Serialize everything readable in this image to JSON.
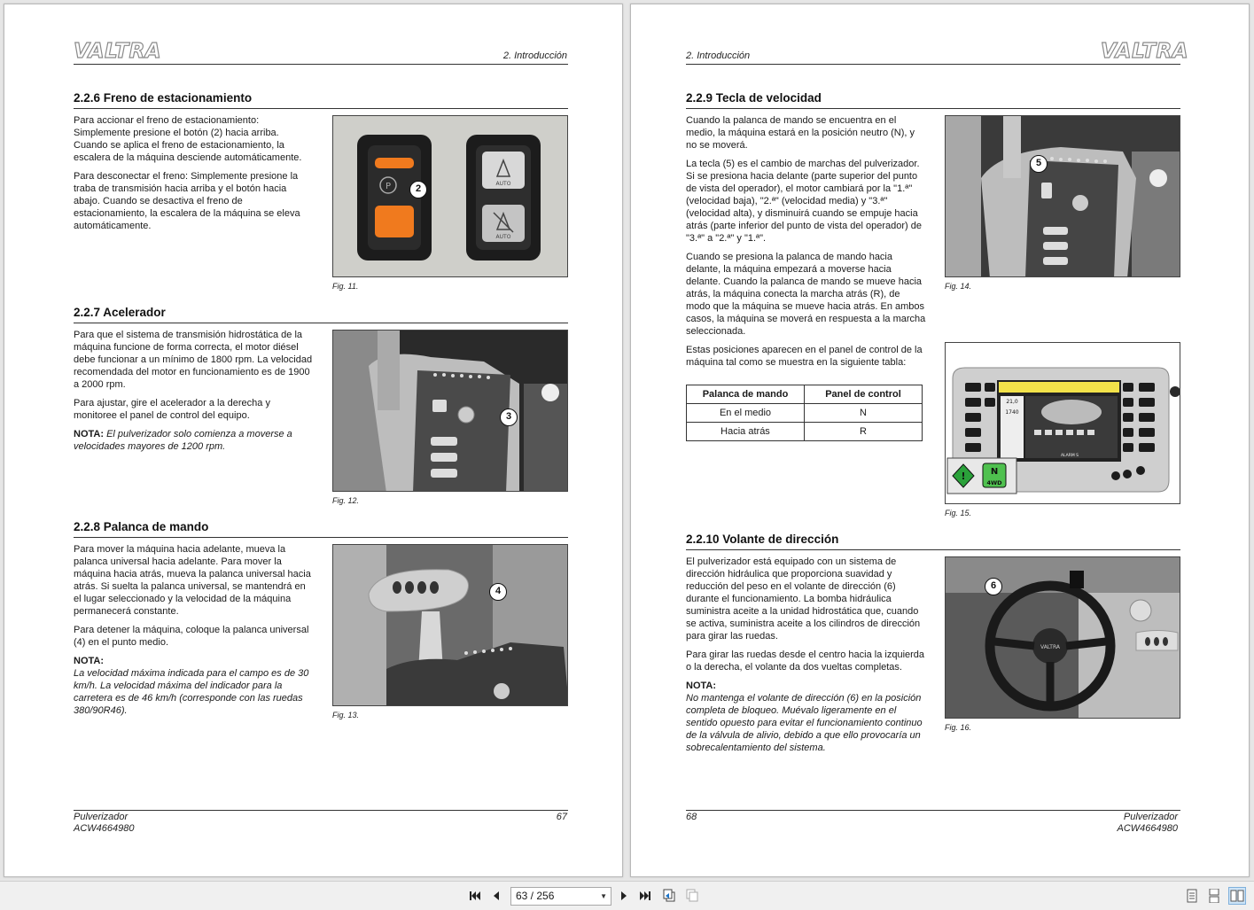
{
  "brand": "VALTRA",
  "left_page": {
    "running_head": "2. Introducción",
    "sections": [
      {
        "heading": "2.2.6  Freno de estacionamiento",
        "paragraphs": [
          "Para accionar el freno de estacionamiento: Simplemente presione el botón (2) hacia arriba. Cuando se aplica el freno de estacionamiento, la escalera de la máquina desciende automáticamente.",
          "Para desconectar el freno: Simplemente presione la traba de transmisión hacia arriba y el botón hacia abajo. Cuando se desactiva el freno de estacionamiento, la escalera de la máquina se eleva automáticamente."
        ],
        "figure_caption": "Fig. 11.",
        "callout": "2",
        "auto_label": "AUTO"
      },
      {
        "heading": "2.2.7  Acelerador",
        "paragraphs": [
          "Para que el sistema de transmisión hidrostática de la máquina funcione de forma correcta, el motor diésel debe funcionar a un mínimo de 1800 rpm. La velocidad recomendada del motor en funcionamiento es de 1900 a 2000 rpm.",
          "Para ajustar, gire el acelerador a la derecha y monitoree el panel de control del equipo."
        ],
        "note_label": "NOTA:",
        "note_text": "El pulverizador solo comienza a moverse a velocidades mayores de 1200 rpm.",
        "figure_caption": "Fig. 12.",
        "callout": "3"
      },
      {
        "heading": "2.2.8  Palanca de mando",
        "paragraphs": [
          "Para mover la máquina hacia adelante, mueva la palanca universal hacia adelante. Para mover la máquina hacia atrás, mueva la palanca universal hacia atrás. Si suelta la palanca universal, se mantendrá en el lugar seleccionado y la velocidad de la máquina permanecerá constante.",
          "Para detener la máquina, coloque la palanca universal (4) en el punto medio."
        ],
        "note_label": "NOTA:",
        "note_text": "La velocidad máxima indicada para el campo es de 30 km/h. La velocidad máxima del indicador para la carretera es de 46 km/h (corresponde con las ruedas 380/90R46).",
        "figure_caption": "Fig. 13.",
        "callout": "4"
      }
    ],
    "footer_left_1": "Pulverizador",
    "footer_left_2": "ACW4664980",
    "page_number": "67"
  },
  "right_page": {
    "running_head": "2. Introducción",
    "sections": [
      {
        "heading": "2.2.9  Tecla de velocidad",
        "paragraphs": [
          "Cuando la palanca de mando se encuentra en el medio, la máquina estará en la posición neutro (N), y no se moverá.",
          "La tecla (5) es el cambio de marchas del pulverizador. Si se presiona hacia delante (parte superior del punto de vista del operador), el motor cambiará por la \"1.ª\" (velocidad baja), \"2.ª\" (velocidad media) y \"3.ª\" (velocidad alta), y disminuirá cuando se empuje hacia atrás (parte inferior del punto de vista del operador) de \"3.ª\" a \"2.ª\" y \"1.ª\".",
          "Cuando se presiona la palanca de mando hacia delante, la máquina empezará a moverse hacia delante. Cuando la palanca de mando se mueve hacia atrás, la máquina conecta la marcha atrás (R), de modo que la máquina se mueve hacia atrás. En ambos casos, la máquina se moverá en respuesta a la marcha seleccionada.",
          "Estas posiciones aparecen en el panel de control de la máquina tal como se muestra en la siguiente tabla:"
        ],
        "table": {
          "headers": [
            "Palanca de mando",
            "Panel de control"
          ],
          "rows": [
            [
              "En el medio",
              "N"
            ],
            [
              "Hacia atrás",
              "R"
            ]
          ]
        },
        "figure_caption_a": "Fig. 14.",
        "figure_caption_b": "Fig. 15.",
        "callout": "5",
        "screen_values": [
          "21,0",
          "1740"
        ],
        "screen_label": "ALARM S",
        "indicator_n": "N",
        "indicator_4wd": "4WD"
      },
      {
        "heading": "2.2.10  Volante de dirección",
        "paragraphs": [
          "El pulverizador está equipado con un sistema de dirección hidráulica que proporciona suavidad y reducción del peso en el volante de dirección (6) durante el funcionamiento. La bomba hidráulica suministra aceite a la unidad hidrostática que, cuando se activa, suministra aceite a los cilindros de dirección para girar las ruedas.",
          "Para girar las ruedas desde el centro hacia la izquierda o la derecha, el volante da dos vueltas completas."
        ],
        "note_label": "NOTA:",
        "note_text": "No mantenga el volante de dirección (6) en la posición completa de bloqueo. Muévalo ligeramente en el sentido opuesto para evitar el funcionamiento continuo de la válvula de alivio, debido a que ello provocaría un sobrecalentamiento del sistema.",
        "figure_caption": "Fig. 16.",
        "callout": "6",
        "wheel_brand": "VALTRA"
      }
    ],
    "footer_right_1": "Pulverizador",
    "footer_right_2": "ACW4664980",
    "page_number": "68"
  },
  "toolbar": {
    "page_indicator": "63 / 256",
    "icons": [
      "first-page-icon",
      "prev-page-icon",
      "next-page-icon",
      "last-page-icon",
      "go-back-icon",
      "go-forward-icon",
      "single-page-view-icon",
      "continuous-view-icon",
      "two-page-view-icon"
    ]
  }
}
